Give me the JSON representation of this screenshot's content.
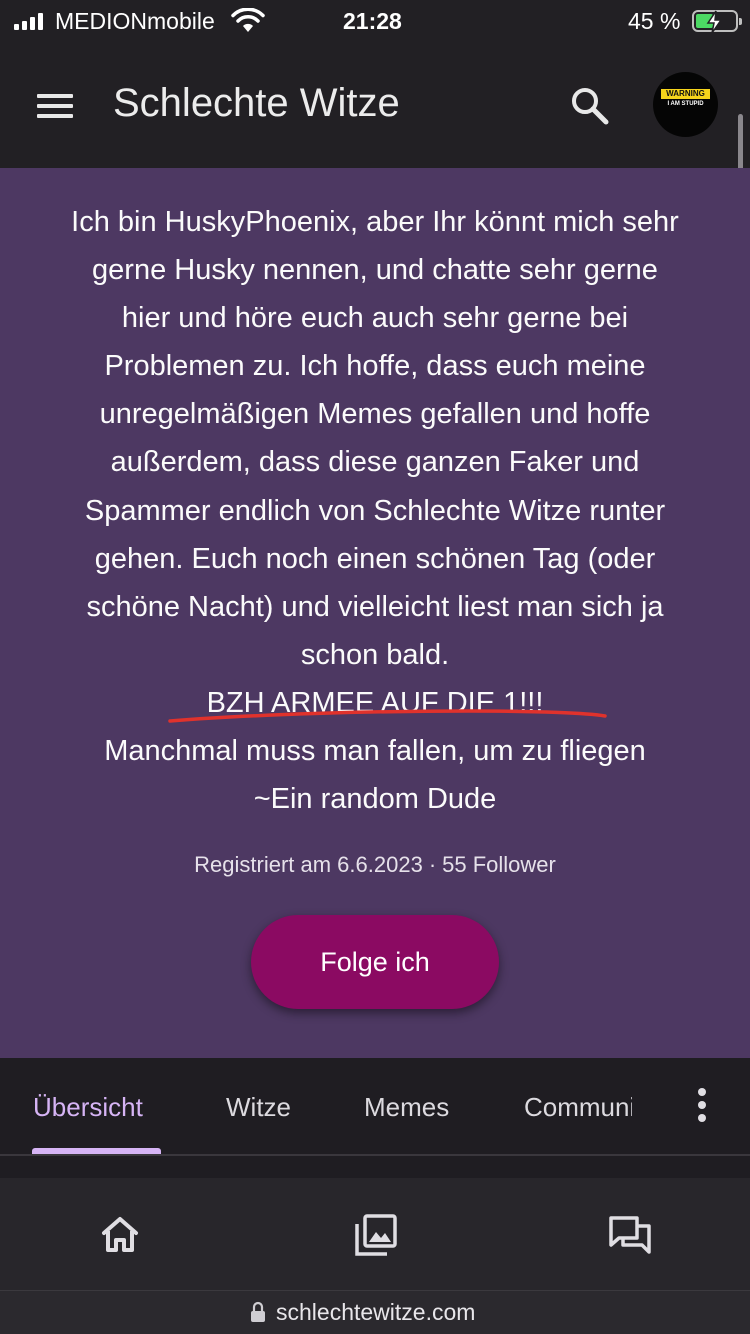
{
  "status_bar": {
    "carrier": "MEDIONmobile",
    "time": "21:28",
    "battery_percent": "45 %",
    "battery_level": 0.45,
    "charging": true
  },
  "app_bar": {
    "title": "Schlechte Witze",
    "avatar": {
      "badge_text": "WARNING",
      "caption": "I AM STUPID"
    }
  },
  "profile": {
    "bio_lines": [
      "Ich bin HuskyPhoenix, aber Ihr könnt mich sehr",
      "gerne Husky nennen, und chatte sehr gerne",
      "hier und höre euch auch sehr gerne bei",
      "Problemen zu. Ich hoffe, dass euch meine",
      "unregelmäßigen Memes gefallen und hoffe",
      "außerdem, dass diese ganzen Faker und",
      "Spammer endlich von Schlechte Witze runter",
      "gehen. Euch noch einen schönen Tag (oder",
      "schöne Nacht) und vielleicht liest man sich ja",
      "schon bald."
    ],
    "highlight_line": "BZH ARMEE AUF DIE 1!!!",
    "quote_line": "Manchmal muss man fallen, um zu fliegen",
    "quote_author": "~Ein random Dude",
    "registered": "Registriert am 6.6.2023",
    "separator": "·",
    "followers": "55 Follower",
    "follow_button": "Folge ich"
  },
  "tabs": {
    "items": [
      {
        "label": "Übersicht"
      },
      {
        "label": "Witze"
      },
      {
        "label": "Memes"
      },
      {
        "label": "Community"
      }
    ]
  },
  "url_bar": {
    "url": "schlechtewitze.com"
  },
  "colors": {
    "profile_bg": "#4d3862",
    "follow_button": "#8b0a62",
    "active_tab": "#d6b4f5",
    "underline_annotation": "#e0322c"
  }
}
